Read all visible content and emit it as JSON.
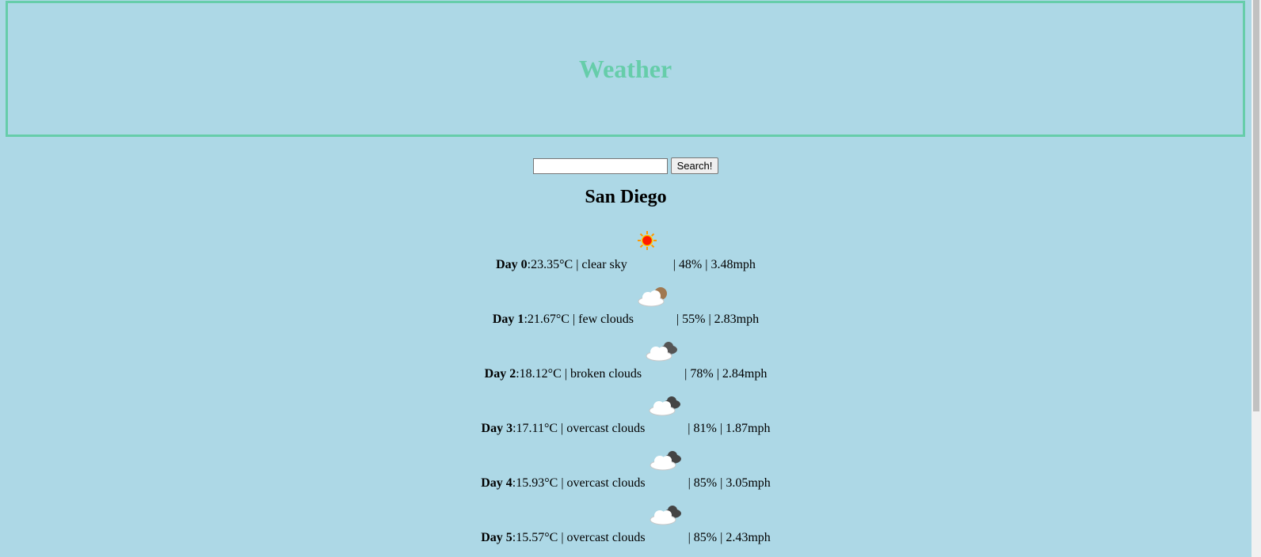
{
  "header": {
    "title": "Weather"
  },
  "search": {
    "input_value": "",
    "button_label": "Search!"
  },
  "city": "San Diego",
  "forecast": [
    {
      "day": "Day 0",
      "temp": "23.35°C",
      "desc": "clear sky",
      "icon": "sun-icon",
      "humidity": "48%",
      "wind": "3.48mph"
    },
    {
      "day": "Day 1",
      "temp": "21.67°C",
      "desc": "few clouds",
      "icon": "few-clouds-icon",
      "humidity": "55%",
      "wind": "2.83mph"
    },
    {
      "day": "Day 2",
      "temp": "18.12°C",
      "desc": "broken clouds",
      "icon": "broken-clouds-icon",
      "humidity": "78%",
      "wind": "2.84mph"
    },
    {
      "day": "Day 3",
      "temp": "17.11°C",
      "desc": "overcast clouds",
      "icon": "overcast-clouds-icon",
      "humidity": "81%",
      "wind": "1.87mph"
    },
    {
      "day": "Day 4",
      "temp": "15.93°C",
      "desc": "overcast clouds",
      "icon": "overcast-clouds-icon",
      "humidity": "85%",
      "wind": "3.05mph"
    },
    {
      "day": "Day 5",
      "temp": "15.57°C",
      "desc": "overcast clouds",
      "icon": "overcast-clouds-icon",
      "humidity": "85%",
      "wind": "2.43mph"
    }
  ],
  "colors": {
    "background": "#add8e6",
    "accent": "#66cdaa"
  }
}
